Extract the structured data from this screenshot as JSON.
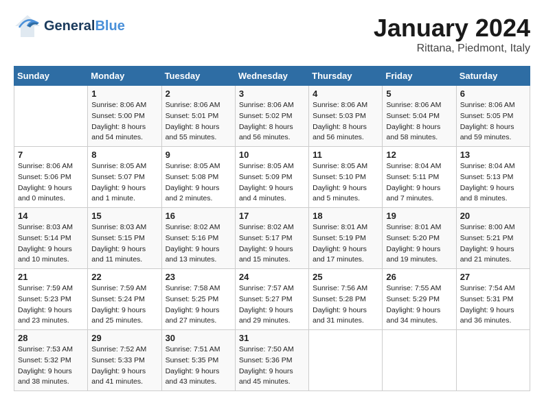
{
  "header": {
    "logo_general": "General",
    "logo_blue": "Blue",
    "month_title": "January 2024",
    "location": "Rittana, Piedmont, Italy"
  },
  "columns": [
    "Sunday",
    "Monday",
    "Tuesday",
    "Wednesday",
    "Thursday",
    "Friday",
    "Saturday"
  ],
  "weeks": [
    [
      {
        "day": "",
        "info": ""
      },
      {
        "day": "1",
        "info": "Sunrise: 8:06 AM\nSunset: 5:00 PM\nDaylight: 8 hours\nand 54 minutes."
      },
      {
        "day": "2",
        "info": "Sunrise: 8:06 AM\nSunset: 5:01 PM\nDaylight: 8 hours\nand 55 minutes."
      },
      {
        "day": "3",
        "info": "Sunrise: 8:06 AM\nSunset: 5:02 PM\nDaylight: 8 hours\nand 56 minutes."
      },
      {
        "day": "4",
        "info": "Sunrise: 8:06 AM\nSunset: 5:03 PM\nDaylight: 8 hours\nand 56 minutes."
      },
      {
        "day": "5",
        "info": "Sunrise: 8:06 AM\nSunset: 5:04 PM\nDaylight: 8 hours\nand 58 minutes."
      },
      {
        "day": "6",
        "info": "Sunrise: 8:06 AM\nSunset: 5:05 PM\nDaylight: 8 hours\nand 59 minutes."
      }
    ],
    [
      {
        "day": "7",
        "info": "Sunrise: 8:06 AM\nSunset: 5:06 PM\nDaylight: 9 hours\nand 0 minutes."
      },
      {
        "day": "8",
        "info": "Sunrise: 8:05 AM\nSunset: 5:07 PM\nDaylight: 9 hours\nand 1 minute."
      },
      {
        "day": "9",
        "info": "Sunrise: 8:05 AM\nSunset: 5:08 PM\nDaylight: 9 hours\nand 2 minutes."
      },
      {
        "day": "10",
        "info": "Sunrise: 8:05 AM\nSunset: 5:09 PM\nDaylight: 9 hours\nand 4 minutes."
      },
      {
        "day": "11",
        "info": "Sunrise: 8:05 AM\nSunset: 5:10 PM\nDaylight: 9 hours\nand 5 minutes."
      },
      {
        "day": "12",
        "info": "Sunrise: 8:04 AM\nSunset: 5:11 PM\nDaylight: 9 hours\nand 7 minutes."
      },
      {
        "day": "13",
        "info": "Sunrise: 8:04 AM\nSunset: 5:13 PM\nDaylight: 9 hours\nand 8 minutes."
      }
    ],
    [
      {
        "day": "14",
        "info": "Sunrise: 8:03 AM\nSunset: 5:14 PM\nDaylight: 9 hours\nand 10 minutes."
      },
      {
        "day": "15",
        "info": "Sunrise: 8:03 AM\nSunset: 5:15 PM\nDaylight: 9 hours\nand 11 minutes."
      },
      {
        "day": "16",
        "info": "Sunrise: 8:02 AM\nSunset: 5:16 PM\nDaylight: 9 hours\nand 13 minutes."
      },
      {
        "day": "17",
        "info": "Sunrise: 8:02 AM\nSunset: 5:17 PM\nDaylight: 9 hours\nand 15 minutes."
      },
      {
        "day": "18",
        "info": "Sunrise: 8:01 AM\nSunset: 5:19 PM\nDaylight: 9 hours\nand 17 minutes."
      },
      {
        "day": "19",
        "info": "Sunrise: 8:01 AM\nSunset: 5:20 PM\nDaylight: 9 hours\nand 19 minutes."
      },
      {
        "day": "20",
        "info": "Sunrise: 8:00 AM\nSunset: 5:21 PM\nDaylight: 9 hours\nand 21 minutes."
      }
    ],
    [
      {
        "day": "21",
        "info": "Sunrise: 7:59 AM\nSunset: 5:23 PM\nDaylight: 9 hours\nand 23 minutes."
      },
      {
        "day": "22",
        "info": "Sunrise: 7:59 AM\nSunset: 5:24 PM\nDaylight: 9 hours\nand 25 minutes."
      },
      {
        "day": "23",
        "info": "Sunrise: 7:58 AM\nSunset: 5:25 PM\nDaylight: 9 hours\nand 27 minutes."
      },
      {
        "day": "24",
        "info": "Sunrise: 7:57 AM\nSunset: 5:27 PM\nDaylight: 9 hours\nand 29 minutes."
      },
      {
        "day": "25",
        "info": "Sunrise: 7:56 AM\nSunset: 5:28 PM\nDaylight: 9 hours\nand 31 minutes."
      },
      {
        "day": "26",
        "info": "Sunrise: 7:55 AM\nSunset: 5:29 PM\nDaylight: 9 hours\nand 34 minutes."
      },
      {
        "day": "27",
        "info": "Sunrise: 7:54 AM\nSunset: 5:31 PM\nDaylight: 9 hours\nand 36 minutes."
      }
    ],
    [
      {
        "day": "28",
        "info": "Sunrise: 7:53 AM\nSunset: 5:32 PM\nDaylight: 9 hours\nand 38 minutes."
      },
      {
        "day": "29",
        "info": "Sunrise: 7:52 AM\nSunset: 5:33 PM\nDaylight: 9 hours\nand 41 minutes."
      },
      {
        "day": "30",
        "info": "Sunrise: 7:51 AM\nSunset: 5:35 PM\nDaylight: 9 hours\nand 43 minutes."
      },
      {
        "day": "31",
        "info": "Sunrise: 7:50 AM\nSunset: 5:36 PM\nDaylight: 9 hours\nand 45 minutes."
      },
      {
        "day": "",
        "info": ""
      },
      {
        "day": "",
        "info": ""
      },
      {
        "day": "",
        "info": ""
      }
    ]
  ]
}
